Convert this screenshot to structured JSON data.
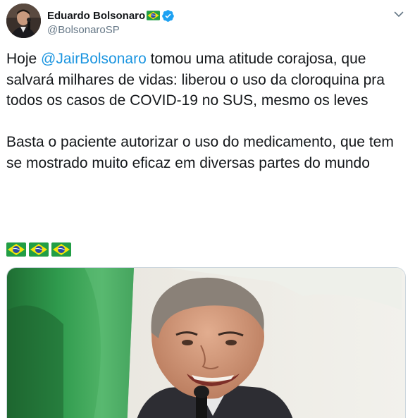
{
  "author": {
    "display_name": "Eduardo Bolsonaro",
    "handle": "@BolsonaroSP",
    "flag_icon": "brazil-flag-icon",
    "verified_icon": "verified-badge-icon"
  },
  "tweet": {
    "para1_before": "Hoje ",
    "mention": "@JairBolsonaro",
    "para1_after": " tomou uma atitude corajosa, que salvará milhares de vidas: liberou o uso da cloroquina pra todos os casos de COVID-19 no SUS, mesmo os leves",
    "para2": "Basta o paciente autorizar o uso do medicamento, que tem se mostrado muito eficaz em diversas partes do mundo",
    "emoji_count": 3
  },
  "colors": {
    "link": "#1b95e0",
    "text": "#14171a",
    "secondary": "#657786",
    "verified": "#1da1f2",
    "flag_green": "#229e45",
    "flag_yellow": "#f8e509",
    "flag_blue": "#2b49a3"
  }
}
